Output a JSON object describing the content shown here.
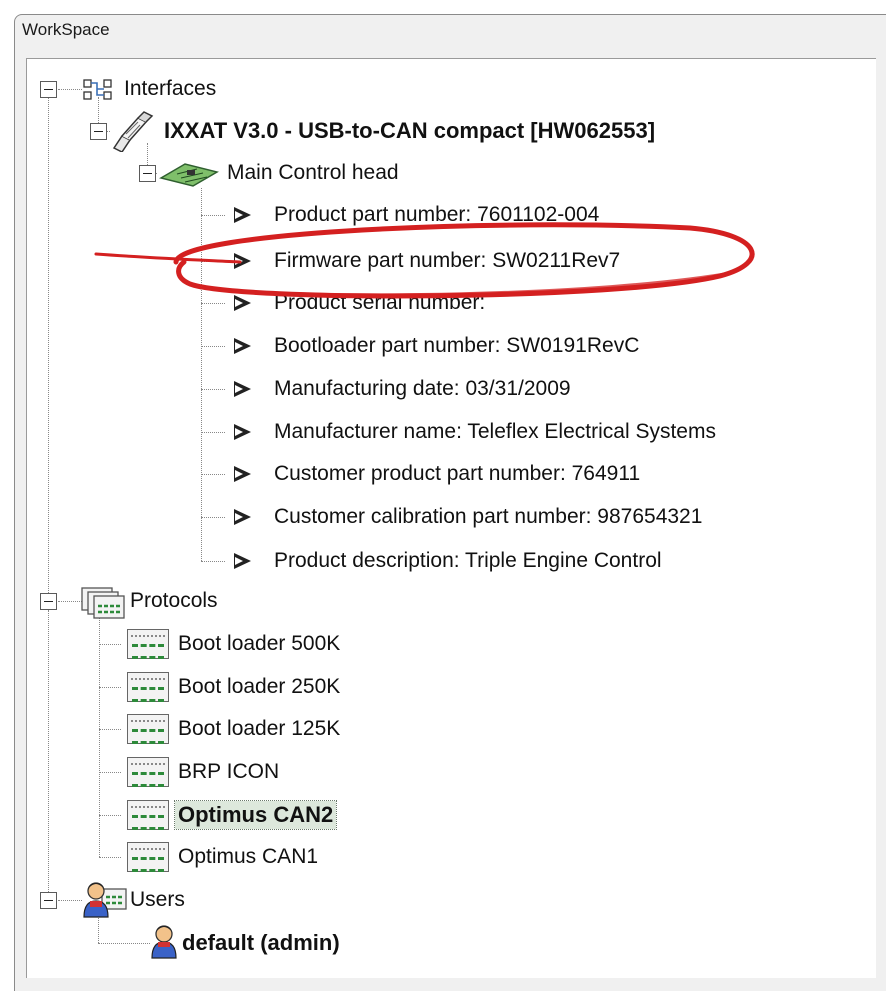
{
  "window": {
    "title": "WorkSpace"
  },
  "tree": {
    "interfaces": {
      "label": "Interfaces",
      "adapter": {
        "label": "IXXAT V3.0 - USB-to-CAN compact [HW062553]",
        "device": {
          "label": "Main Control head",
          "properties": [
            "Product part number: 7601102-004",
            "Firmware part number: SW0211Rev7",
            "Product serial number:",
            "Bootloader part number: SW0191RevC",
            "Manufacturing date: 03/31/2009",
            "Manufacturer name: Teleflex Electrical Systems",
            "Customer product part number: 764911",
            "Customer calibration part number: 987654321",
            "Product description: Triple Engine Control"
          ]
        }
      }
    },
    "protocols": {
      "label": "Protocols",
      "items": [
        "Boot loader 500K",
        "Boot loader 250K",
        "Boot loader 125K",
        "BRP ICON",
        "Optimus CAN2",
        "Optimus CAN1"
      ],
      "selected": "Optimus CAN2"
    },
    "users": {
      "label": "Users",
      "items": [
        "default (admin)"
      ]
    }
  },
  "annotation": {
    "color": "#d42020",
    "target": "Firmware part number: SW0211Rev7"
  },
  "colors": {
    "protocol_icon_accent": "#2d8a3a",
    "selection_bg": "#dde8dc"
  }
}
